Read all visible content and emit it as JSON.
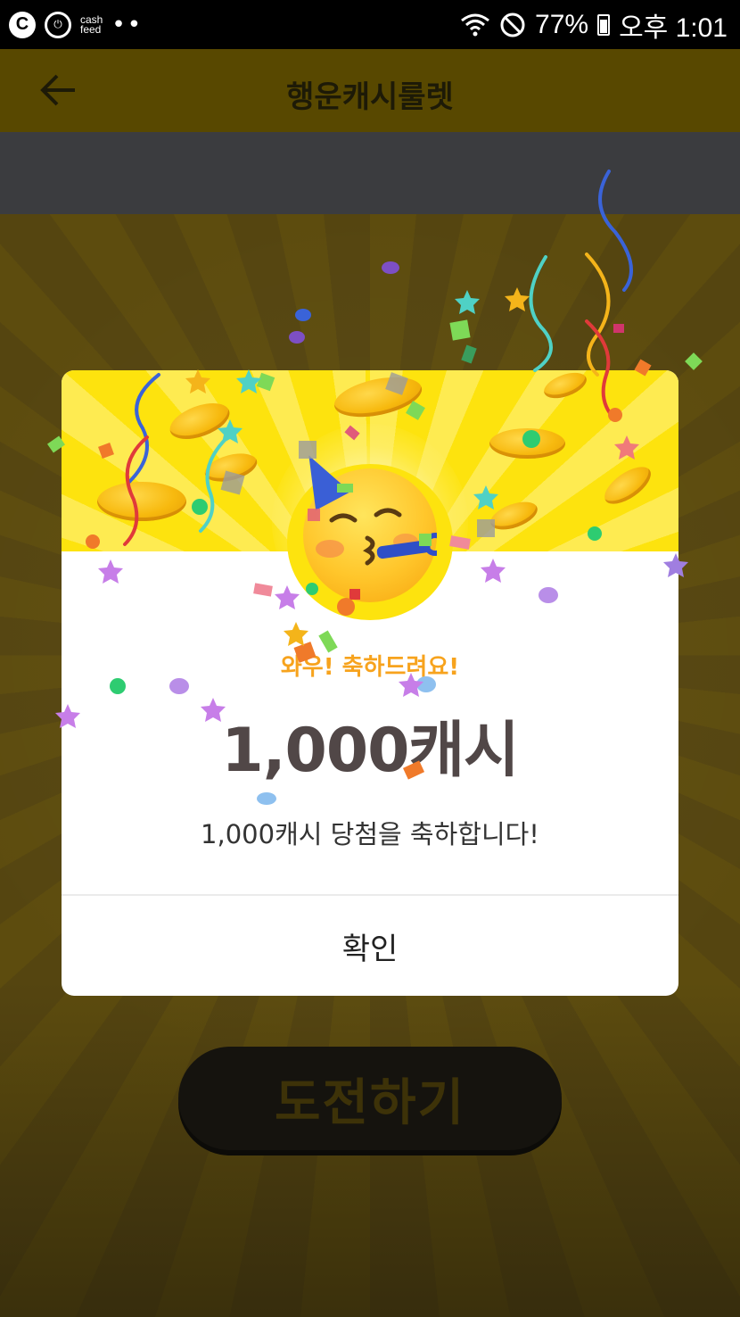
{
  "status_bar": {
    "app_icon_1": "C",
    "cashfeed_logo": "cash\nfeed",
    "dots": "••",
    "battery": "77%",
    "time": "오후 1:01",
    "icons": [
      "wifi-icon",
      "do-not-disturb-icon",
      "battery-icon"
    ]
  },
  "app_bar": {
    "title": "행운캐시룰렛"
  },
  "challenge_button": {
    "label": "도전하기"
  },
  "dialog": {
    "congrats_text": "와우! 축하드려요!",
    "amount_text": "1,000캐시",
    "message_text": "1,000캐시 당첨을 축하합니다!",
    "confirm_label": "확인",
    "emoji": "partying-face-icon"
  },
  "colors": {
    "banner_yellow": "#fde30e",
    "congrats_orange": "#f7a31d",
    "amount_text": "#514747",
    "overlay_background": "#5a4a12",
    "status_bar": "#000000"
  }
}
